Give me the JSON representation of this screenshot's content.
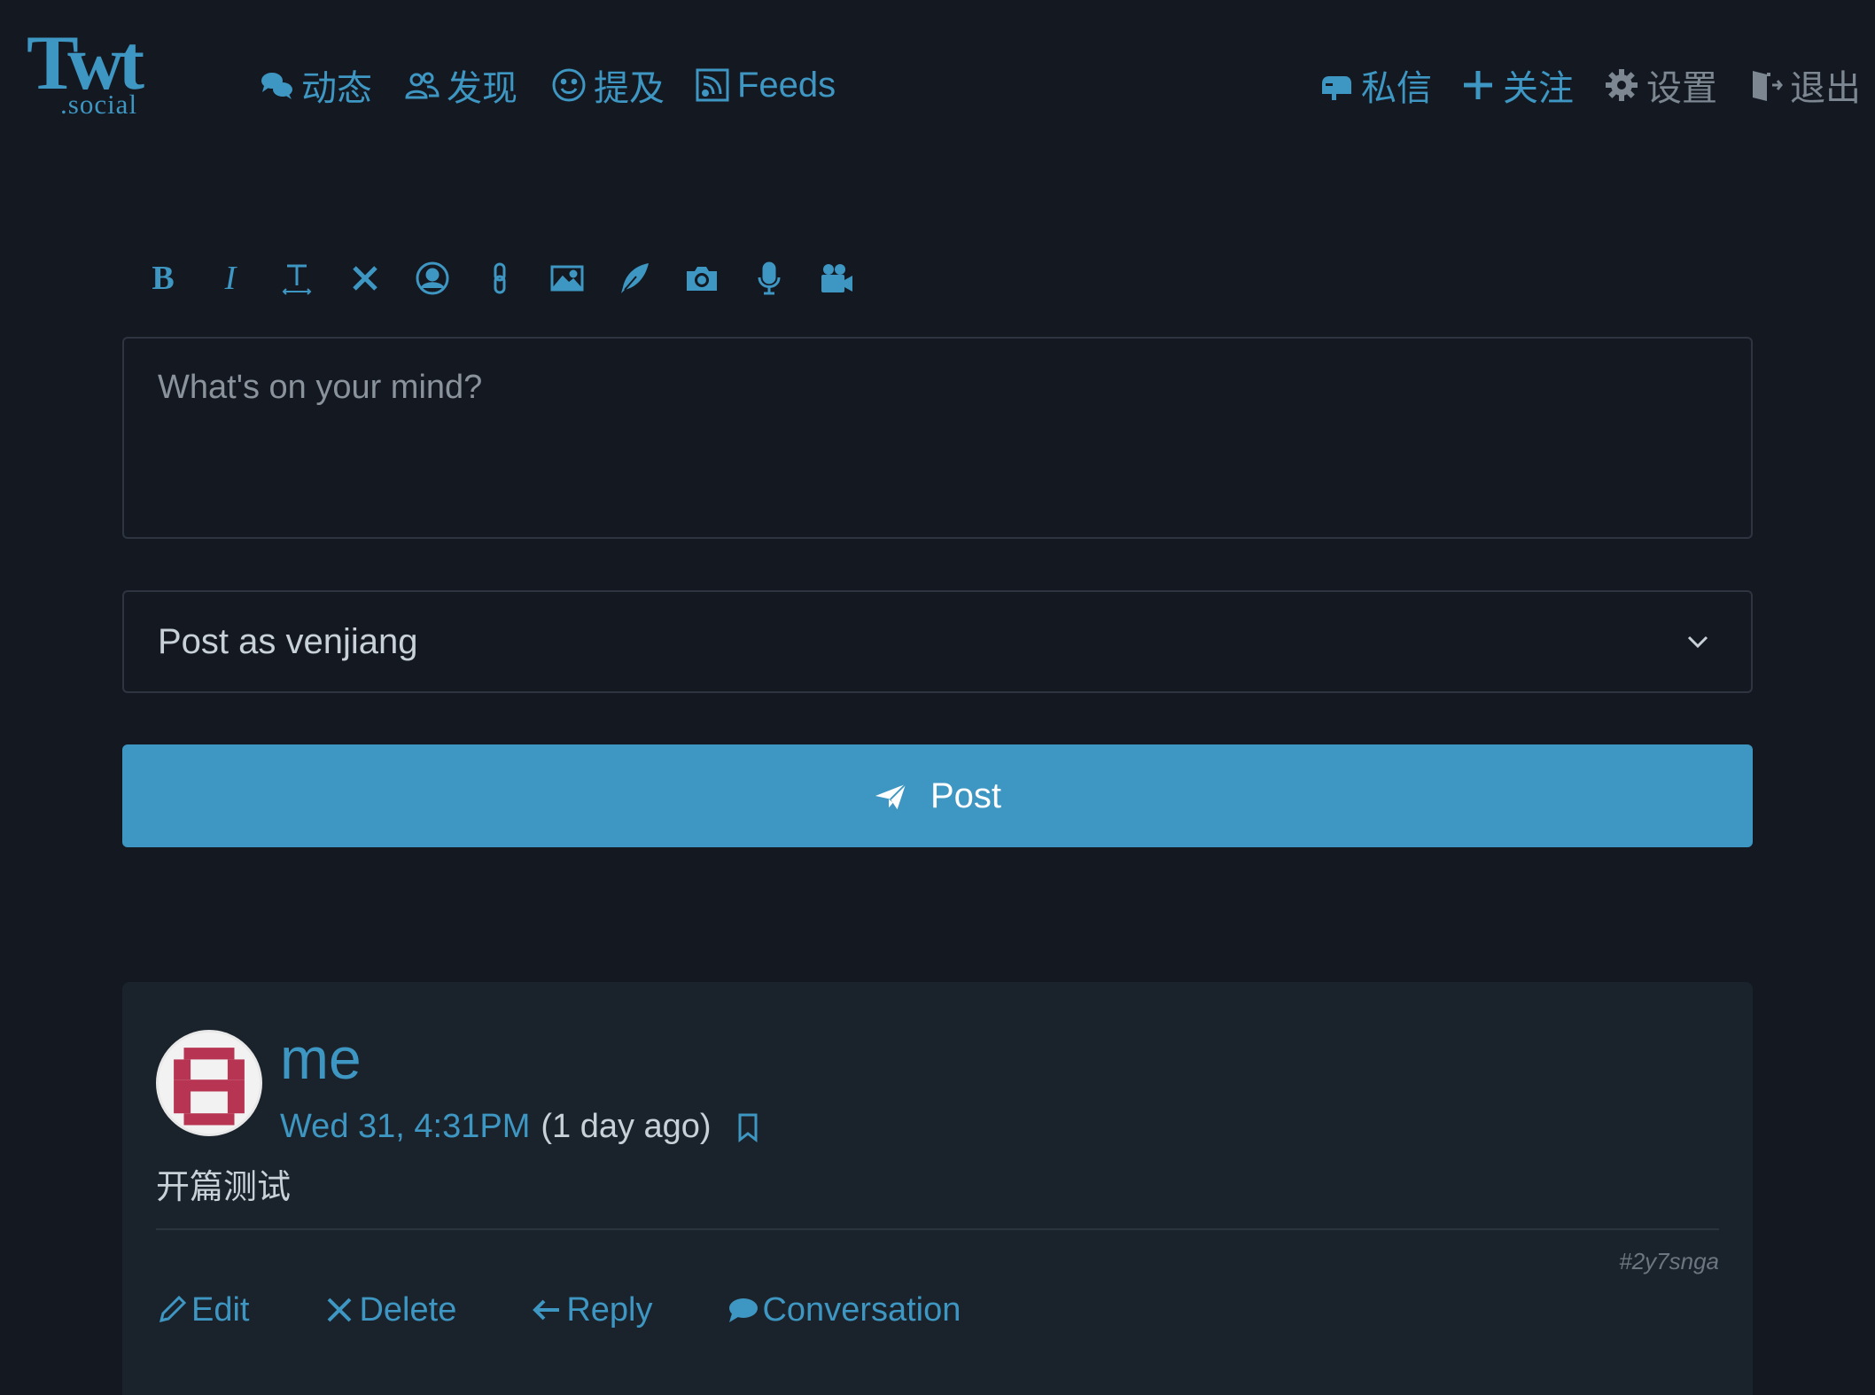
{
  "brand": {
    "logo_main": "Twt",
    "logo_sub": ".social"
  },
  "nav": {
    "left": [
      {
        "label": "动态",
        "icon": "comments-icon"
      },
      {
        "label": "发现",
        "icon": "users-icon"
      },
      {
        "label": "提及",
        "icon": "smile-icon"
      },
      {
        "label": "Feeds",
        "icon": "rss-icon"
      }
    ],
    "right": [
      {
        "label": "私信",
        "icon": "mailbox-icon"
      },
      {
        "label": "关注",
        "icon": "plus-icon"
      },
      {
        "label": "设置",
        "icon": "gear-icon"
      },
      {
        "label": "退出",
        "icon": "door-exit-icon"
      }
    ]
  },
  "toolbar": {
    "bold": "B",
    "italic": "I",
    "tools": [
      "bold-icon",
      "italic-icon",
      "text-height-icon",
      "strikethrough-icon",
      "user-mention-icon",
      "link-icon",
      "image-icon",
      "quill-icon",
      "camera-icon",
      "microphone-icon",
      "video-icon"
    ]
  },
  "composer": {
    "placeholder": "What's on your mind?",
    "value": ""
  },
  "post_as": {
    "selected": "Post as venjiang"
  },
  "post_button": {
    "label": "Post"
  },
  "post": {
    "author": "me",
    "timestamp": "Wed 31, 4:31PM",
    "relative": "(1 day ago)",
    "content": "开篇测试",
    "hash": "#2y7snga",
    "actions": {
      "edit": "Edit",
      "delete": "Delete",
      "reply": "Reply",
      "conversation": "Conversation"
    }
  },
  "colors": {
    "background": "#141821",
    "accent": "#3e96c2",
    "card": "#1a232b",
    "muted": "#7c8792"
  }
}
